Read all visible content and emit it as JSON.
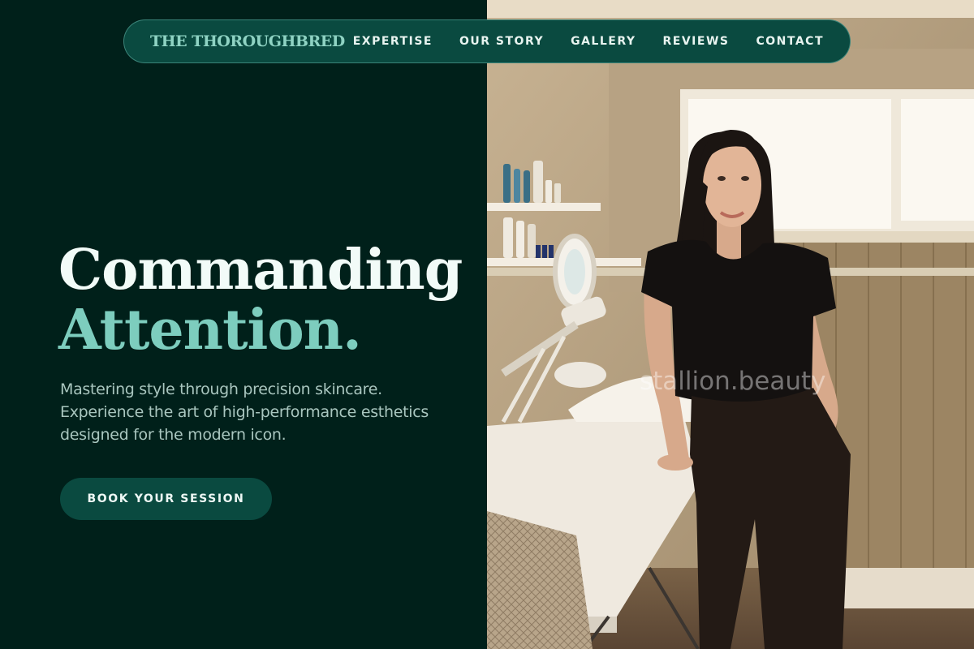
{
  "nav": {
    "brand": "THE THOROUGHBRED",
    "links": [
      "EXPERTISE",
      "OUR STORY",
      "GALLERY",
      "REVIEWS",
      "CONTACT"
    ]
  },
  "hero": {
    "title_line1": "Commanding",
    "title_line2": "Attention.",
    "subtitle": "Mastering style through precision skincare. Experience the art of high-performance esthetics designed for the modern icon.",
    "cta": "BOOK YOUR SESSION",
    "image_alt": "Esthetician leaning on a treatment bed in a skincare studio"
  },
  "watermark": "stallion.beauty",
  "colors": {
    "background": "#00201a",
    "nav_background": "#0a4a40",
    "accent": "#7dcdbe",
    "brand": "#8fd3c3"
  }
}
